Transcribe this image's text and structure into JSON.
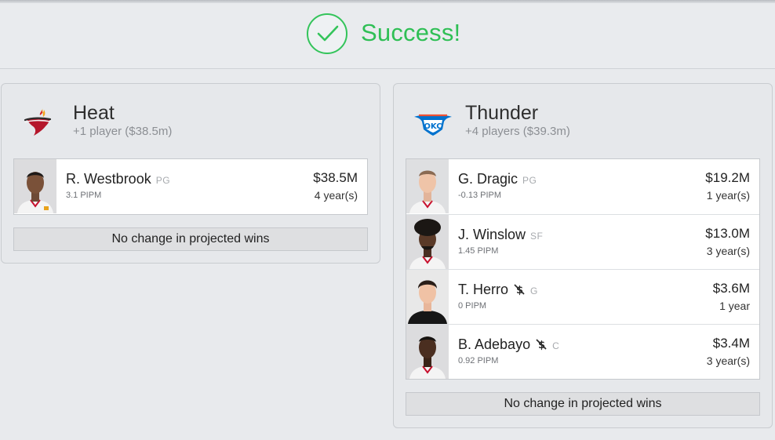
{
  "status": {
    "message": "Success!",
    "icon": "check-circle-icon",
    "color": "#2fbf55"
  },
  "teams": [
    {
      "name": "Heat",
      "summary": "+1 player ($38.5m)",
      "logo": "heat-logo-icon",
      "players": [
        {
          "name": "R. Westbrook",
          "position": "PG",
          "pipm": "3.1 PIPM",
          "salary": "$38.5M",
          "years": "4 year(s)",
          "no_trade": false
        }
      ],
      "projection": "No change in projected wins"
    },
    {
      "name": "Thunder",
      "summary": "+4 players ($39.3m)",
      "logo": "thunder-logo-icon",
      "players": [
        {
          "name": "G. Dragic",
          "position": "PG",
          "pipm": "-0.13 PIPM",
          "salary": "$19.2M",
          "years": "1 year(s)",
          "no_trade": false
        },
        {
          "name": "J. Winslow",
          "position": "SF",
          "pipm": "1.45 PIPM",
          "salary": "$13.0M",
          "years": "3 year(s)",
          "no_trade": false
        },
        {
          "name": "T. Herro",
          "position": "G",
          "pipm": "0 PIPM",
          "salary": "$3.6M",
          "years": "1 year",
          "no_trade": true
        },
        {
          "name": "B. Adebayo",
          "position": "C",
          "pipm": "0.92 PIPM",
          "salary": "$3.4M",
          "years": "3 year(s)",
          "no_trade": true
        }
      ],
      "projection": "No change in projected wins"
    }
  ]
}
